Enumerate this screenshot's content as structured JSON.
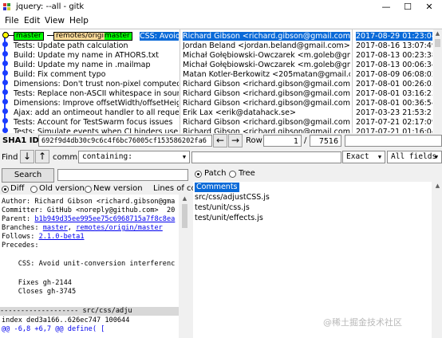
{
  "window": {
    "title": "jquery: --all - gitk",
    "min_glyph": "—",
    "max_glyph": "☐",
    "close_glyph": "✕"
  },
  "menu": [
    "File",
    "Edit",
    "View",
    "Help"
  ],
  "refs": {
    "head": "master",
    "remote_prefix": "remotes/origin/",
    "remote_branch": "master"
  },
  "commits": [
    {
      "subject": "CSS: Avoid unit-conversion interference",
      "author": "Richard Gibson <richard.gibson@gmail.com>",
      "date": "2017-08-29 01:23:04"
    },
    {
      "subject": "Tests: Update path calculation",
      "author": "Jordan Beland <jordan.beland@gmail.com>",
      "date": "2017-08-16 13:07:49"
    },
    {
      "subject": "Build: Update my name in ATHORS.txt",
      "author": "Michał Gołębiowski-Owczarek <m.goleb@gmail.c",
      "date": "2017-08-13 00:23:38"
    },
    {
      "subject": "Build: Update my name in .mailmap",
      "author": "Michał Gołębiowski-Owczarek <m.goleb@gmail.c",
      "date": "2017-08-13 00:06:34"
    },
    {
      "subject": "Build: Fix comment typo",
      "author": "Matan Kotler-Berkowitz <205matan@gmail.com>",
      "date": "2017-08-09 06:08:02"
    },
    {
      "subject": "Dimensions: Don't trust non-pixel computed widths",
      "author": "Richard Gibson <richard.gibson@gmail.com>",
      "date": "2017-08-01 00:26:03"
    },
    {
      "subject": "Tests: Replace non-ASCII whitespace in source code",
      "author": "Richard Gibson <richard.gibson@gmail.com>",
      "date": "2017-08-01 03:16:23"
    },
    {
      "subject": "Dimensions: Improve offsetWidth/offsetHeight fallback",
      "author": "Richard Gibson <richard.gibson@gmail.com>",
      "date": "2017-08-01 00:36:54"
    },
    {
      "subject": "Ajax: add an ontimeout handler to all requests",
      "author": "Erik Lax <erik@datahack.se>",
      "date": "2017-03-23 21:53:21"
    },
    {
      "subject": "Tests: Account for TestSwarm focus issues",
      "author": "Richard Gibson <richard.gibson@gmail.com>",
      "date": "2017-07-21 02:17:09"
    },
    {
      "subject": "Tests: Simulate events when CI hinders use of native ones",
      "author": "Richard Gibson <richard.gibson@gmail.com>",
      "date": "2017-07-21 01:16:04"
    }
  ],
  "sha": {
    "label": "SHA1 ID:",
    "value": "692f9d4db30c9c6c4f6bc76005cf153586202fa6",
    "row_label": "Row",
    "row_current": "1",
    "row_sep": "/",
    "row_total": "7516"
  },
  "find": {
    "label": "Find",
    "commit_label": "commit",
    "mode": "containing:",
    "match": "Exact",
    "fields": "All fields"
  },
  "search": {
    "button": "Search",
    "query": ""
  },
  "diff_options": {
    "diff": "Diff",
    "old": "Old version",
    "new": "New version",
    "lines_label": "Lines of co"
  },
  "view_options": {
    "patch": "Patch",
    "tree": "Tree"
  },
  "details": {
    "author": "Author: Richard Gibson <richard.gibson@gma",
    "committer": "Committer: GitHub <noreply@github.com>  20",
    "parent_label": "Parent: ",
    "parent_link": "b1b949d35ee995ee75c6968715a7f8c8ea",
    "branches_label": "Branches: ",
    "branch1": "master",
    "branch_sep": ", ",
    "branch2": "remotes/origin/master",
    "follows_label": "Follows: ",
    "follows_link": "2.1.0-beta1",
    "precedes": "Precedes:",
    "message": "    CSS: Avoid unit-conversion interferenc",
    "fixes": "    Fixes gh-2144",
    "closes": "    Closes gh-3745",
    "file_header": "------------------- src/css/adju",
    "index_line": "index ded3a166..626ec747 100644",
    "hunk": "@@ -6,8 +6,7 @@ define( ["
  },
  "files": {
    "header": "Comments",
    "items": [
      "src/css/adjustCSS.js",
      "test/unit/css.js",
      "test/unit/effects.js"
    ]
  },
  "watermark": "@稀土掘金技术社区",
  "colors": {
    "selection": "#0a6ad8",
    "graph": "#1a3cff",
    "head_tag": "#00ff00",
    "remote_tag": "#ffdd9a",
    "yellow": "#ffff00",
    "link": "#0000ee",
    "diff_header": "#0000ee"
  }
}
